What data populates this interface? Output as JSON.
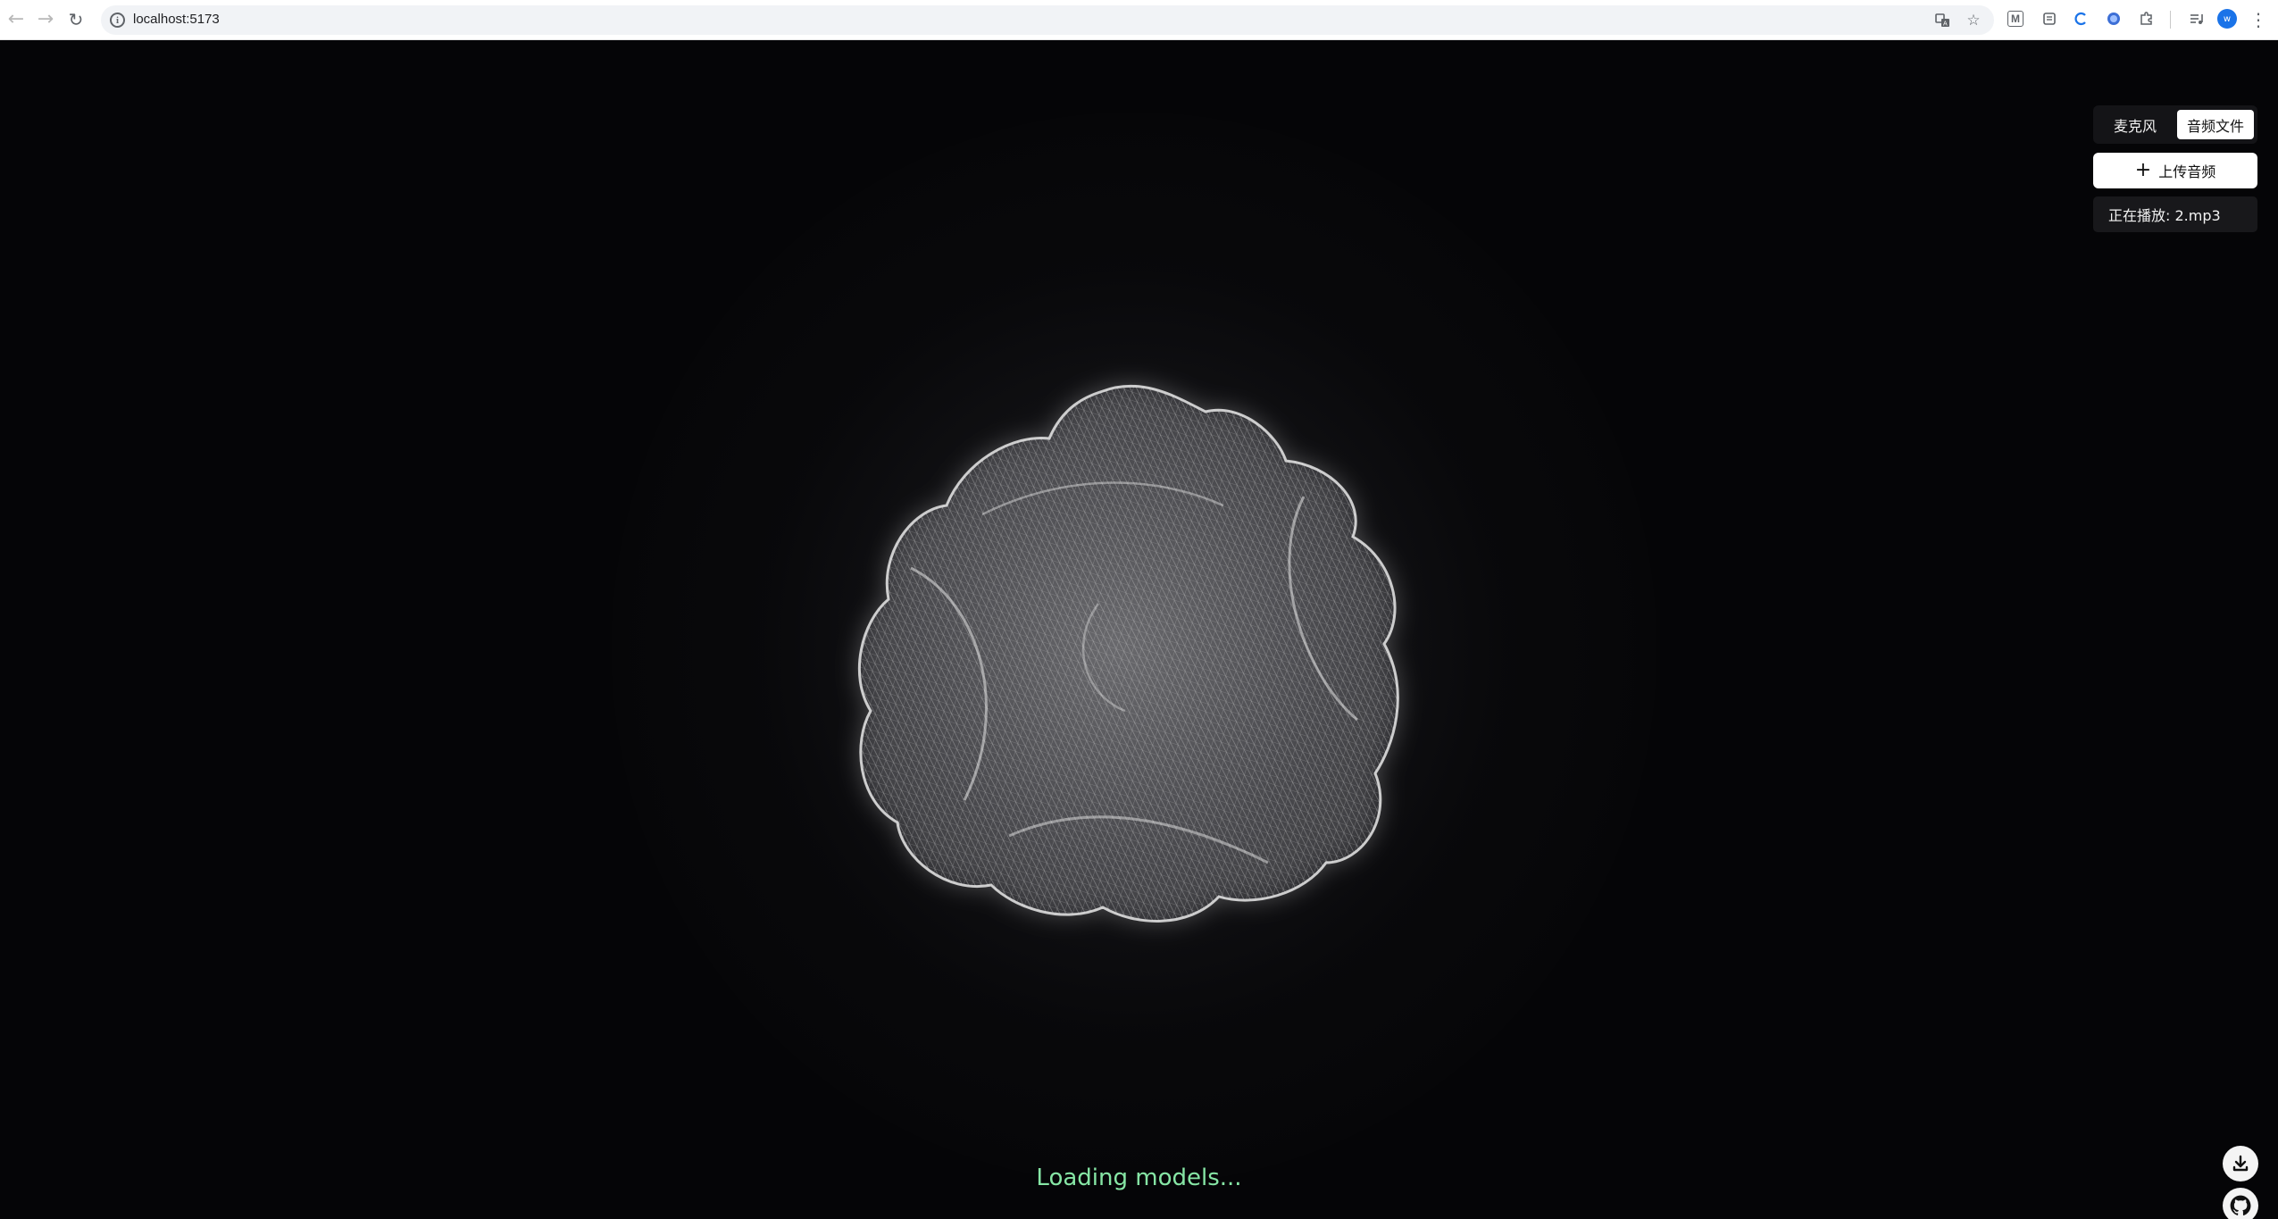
{
  "browser": {
    "url": "localhost:5173",
    "avatar_letter": "w",
    "icons": [
      "back-arrow-icon",
      "forward-arrow-icon",
      "reload-icon",
      "site-info-icon",
      "translate-icon",
      "bookmark-star-icon",
      "extensions-puzzle-icon",
      "profile-avatar",
      "more-menu-icon"
    ],
    "extension_labels": [
      "M"
    ]
  },
  "panel": {
    "mode_microphone": "麦克风",
    "mode_audio_file": "音频文件",
    "active_mode": "音频文件",
    "upload_label": "上传音频",
    "now_playing": "正在播放: 2.mp3"
  },
  "status": {
    "loading_text": "Loading models..."
  },
  "colors": {
    "background": "#050507",
    "loading_text": "#86e6a5",
    "wireframe": "#dcdcdc",
    "panel_dark": "#141417"
  }
}
